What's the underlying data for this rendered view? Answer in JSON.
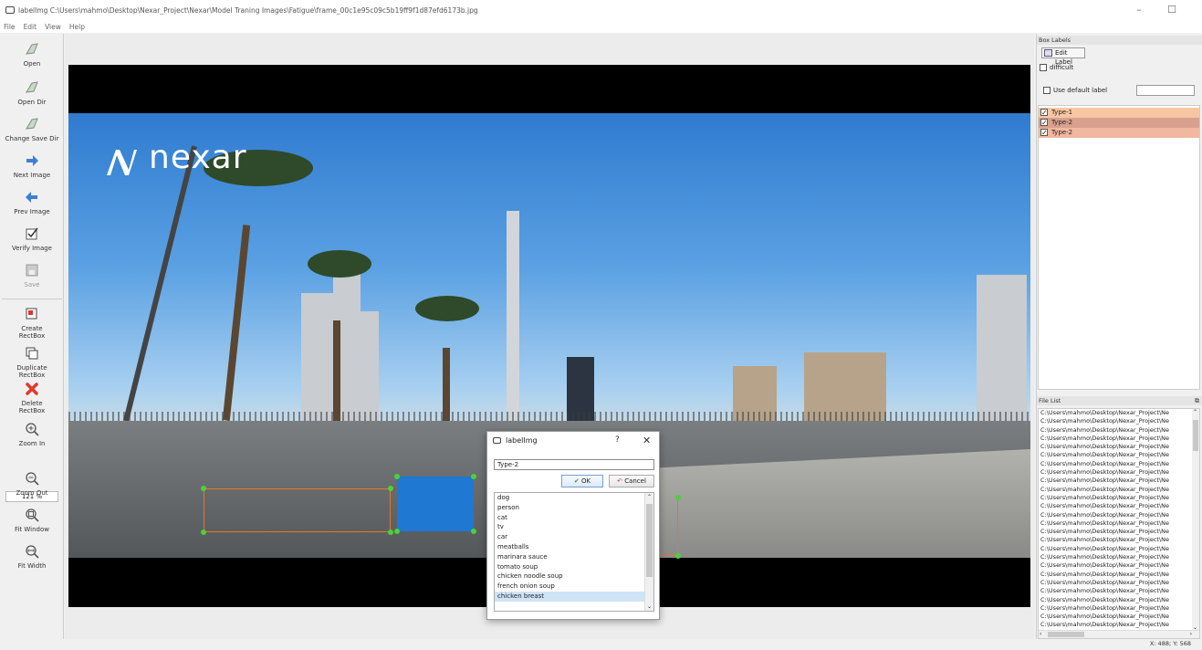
{
  "window": {
    "title": "labelImg C:\\Users\\mahmo\\Desktop\\Nexar_Project\\Nexar\\Model Traning Images\\Fatigue\\frame_00c1e95c09c5b19ff9f1d87efd6173b.jpg",
    "controls": {
      "minimize": "–",
      "maximize": "☐",
      "close": "✕"
    }
  },
  "menu": [
    "File",
    "Edit",
    "View",
    "Help"
  ],
  "toolbar": {
    "tools": [
      {
        "name": "open",
        "label": "Open",
        "icon": "open-icon"
      },
      {
        "name": "open-dir",
        "label": "Open Dir",
        "icon": "open-dir-icon"
      },
      {
        "name": "change-save-dir",
        "label": "Change Save Dir",
        "icon": "change-save-dir-icon"
      },
      {
        "name": "next-image",
        "label": "Next Image",
        "icon": "arrow-right-icon"
      },
      {
        "name": "prev-image",
        "label": "Prev Image",
        "icon": "arrow-left-icon"
      },
      {
        "name": "verify-image",
        "label": "Verify Image",
        "icon": "checkbox-icon"
      },
      {
        "name": "save",
        "label": "Save",
        "icon": "save-icon"
      },
      {
        "name": "create-rectbox",
        "label": "Create\nRectBox",
        "icon": "create-rectbox-icon"
      },
      {
        "name": "duplicate-rectbox",
        "label": "Duplicate\nRectBox",
        "icon": "duplicate-icon"
      },
      {
        "name": "delete-rectbox",
        "label": "Delete\nRectBox",
        "icon": "delete-icon"
      },
      {
        "name": "zoom-in",
        "label": "Zoom In",
        "icon": "zoom-in-icon"
      },
      {
        "name": "zoom-out",
        "label": "Zoom Out",
        "icon": "zoom-out-icon"
      },
      {
        "name": "fit-window",
        "label": "Fit Window",
        "icon": "fit-window-icon"
      },
      {
        "name": "fit-width",
        "label": "Fit Width",
        "icon": "fit-width-icon"
      }
    ],
    "zoom_value": "121 %"
  },
  "image": {
    "logo_text": "nexar"
  },
  "dialog": {
    "title": "labelImg",
    "help": "?",
    "close": "✕",
    "input_value": "Type-2",
    "ok_label": "OK",
    "cancel_label": "Cancel",
    "options": [
      "dog",
      "person",
      "cat",
      "tv",
      "car",
      "meatballs",
      "marinara sauce",
      "tomato soup",
      "chicken noodle soup",
      "french onion soup",
      "chicken breast"
    ],
    "selected": "chicken breast"
  },
  "box_labels": {
    "title": "Box Labels",
    "edit_label": "Edit Label",
    "difficult_label": "difficult",
    "difficult_checked": false,
    "use_default_label": "Use default label",
    "use_default_checked": false,
    "default_value": "",
    "items": [
      {
        "text": "Type-1",
        "checked": true,
        "color": "#f7c7a3"
      },
      {
        "text": "Type-2",
        "checked": true,
        "color": "#d9a08f"
      },
      {
        "text": "Type-2",
        "checked": true,
        "color": "#f2b79f"
      }
    ]
  },
  "file_list": {
    "title": "File List",
    "rows": [
      "C:\\Users\\mahmo\\Desktop\\Nexar_Project\\Ne",
      "C:\\Users\\mahmo\\Desktop\\Nexar_Project\\Ne",
      "C:\\Users\\mahmo\\Desktop\\Nexar_Project\\Ne",
      "C:\\Users\\mahmo\\Desktop\\Nexar_Project\\Ne",
      "C:\\Users\\mahmo\\Desktop\\Nexar_Project\\Ne",
      "C:\\Users\\mahmo\\Desktop\\Nexar_Project\\Ne",
      "C:\\Users\\mahmo\\Desktop\\Nexar_Project\\Ne",
      "C:\\Users\\mahmo\\Desktop\\Nexar_Project\\Ne",
      "C:\\Users\\mahmo\\Desktop\\Nexar_Project\\Ne",
      "C:\\Users\\mahmo\\Desktop\\Nexar_Project\\Ne",
      "C:\\Users\\mahmo\\Desktop\\Nexar_Project\\Ne",
      "C:\\Users\\mahmo\\Desktop\\Nexar_Project\\Ne",
      "C:\\Users\\mahmo\\Desktop\\Nexar_Project\\Ne",
      "C:\\Users\\mahmo\\Desktop\\Nexar_Project\\Ne",
      "C:\\Users\\mahmo\\Desktop\\Nexar_Project\\Ne",
      "C:\\Users\\mahmo\\Desktop\\Nexar_Project\\Ne",
      "C:\\Users\\mahmo\\Desktop\\Nexar_Project\\Ne",
      "C:\\Users\\mahmo\\Desktop\\Nexar_Project\\Ne",
      "C:\\Users\\mahmo\\Desktop\\Nexar_Project\\Ne",
      "C:\\Users\\mahmo\\Desktop\\Nexar_Project\\Ne",
      "C:\\Users\\mahmo\\Desktop\\Nexar_Project\\Ne",
      "C:\\Users\\mahmo\\Desktop\\Nexar_Project\\Ne",
      "C:\\Users\\mahmo\\Desktop\\Nexar_Project\\Ne",
      "C:\\Users\\mahmo\\Desktop\\Nexar_Project\\Ne",
      "C:\\Users\\mahmo\\Desktop\\Nexar_Project\\Ne",
      "C:\\Users\\mahmo\\Desktop\\Nexar_Project\\Ne"
    ]
  },
  "status": {
    "coords": "X: 488; Y: 568"
  },
  "colors": {
    "bbox_outline": "#e07a2a",
    "bbox_fill": "#1f78d1",
    "handle": "#4cd137"
  }
}
